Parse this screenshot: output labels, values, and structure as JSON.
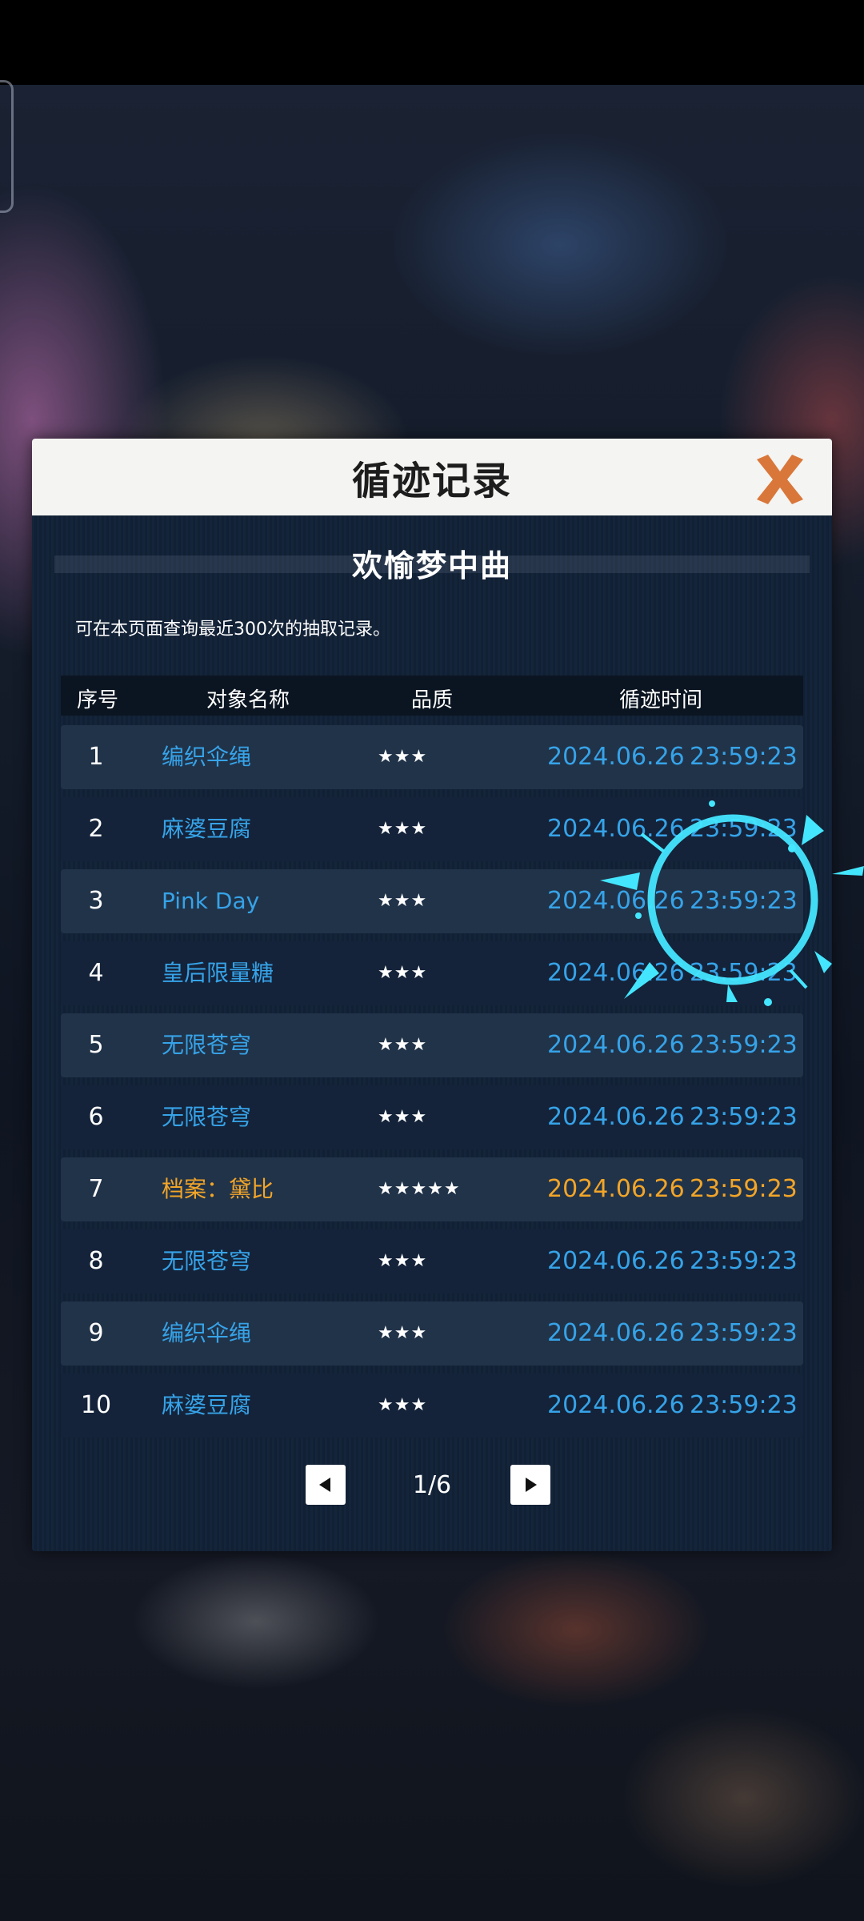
{
  "dialog": {
    "title": "循迹记录",
    "banner_title": "欢愉梦中曲",
    "info": "可在本页面查询最近300次的抽取记录。"
  },
  "table": {
    "headers": [
      "序号",
      "对象名称",
      "品质",
      "循迹时间"
    ],
    "rows": [
      {
        "index": "1",
        "name": "编织伞绳",
        "stars": "★★★",
        "date": "2024.06.26",
        "time": "23:59:23"
      },
      {
        "index": "2",
        "name": "麻婆豆腐",
        "stars": "★★★",
        "date": "2024.06.26",
        "time": "23:59:23"
      },
      {
        "index": "3",
        "name": "Pink Day",
        "stars": "★★★",
        "date": "2024.06.26",
        "time": "23:59:23"
      },
      {
        "index": "4",
        "name": "皇后限量糖",
        "stars": "★★★",
        "date": "2024.06.26",
        "time": "23:59:23"
      },
      {
        "index": "5",
        "name": "无限苍穹",
        "stars": "★★★",
        "date": "2024.06.26",
        "time": "23:59:23"
      },
      {
        "index": "6",
        "name": "无限苍穹",
        "stars": "★★★",
        "date": "2024.06.26",
        "time": "23:59:23"
      },
      {
        "index": "7",
        "name": "档案：黛比",
        "stars": "★★★★★",
        "date": "2024.06.26",
        "time": "23:59:23"
      },
      {
        "index": "8",
        "name": "无限苍穹",
        "stars": "★★★",
        "date": "2024.06.26",
        "time": "23:59:23"
      },
      {
        "index": "9",
        "name": "编织伞绳",
        "stars": "★★★",
        "date": "2024.06.26",
        "time": "23:59:23"
      },
      {
        "index": "10",
        "name": "麻婆豆腐",
        "stars": "★★★",
        "date": "2024.06.26",
        "time": "23:59:23"
      }
    ]
  },
  "pager": {
    "label": "1/6"
  },
  "colors": {
    "name_blue": "#36a3e8",
    "gold": "#f2a528",
    "close_orange": "#d9773a",
    "fx_cyan": "#44e6ff"
  },
  "icons": {
    "close": "close-icon",
    "prev": "triangle-left-icon",
    "next": "triangle-right-icon"
  }
}
